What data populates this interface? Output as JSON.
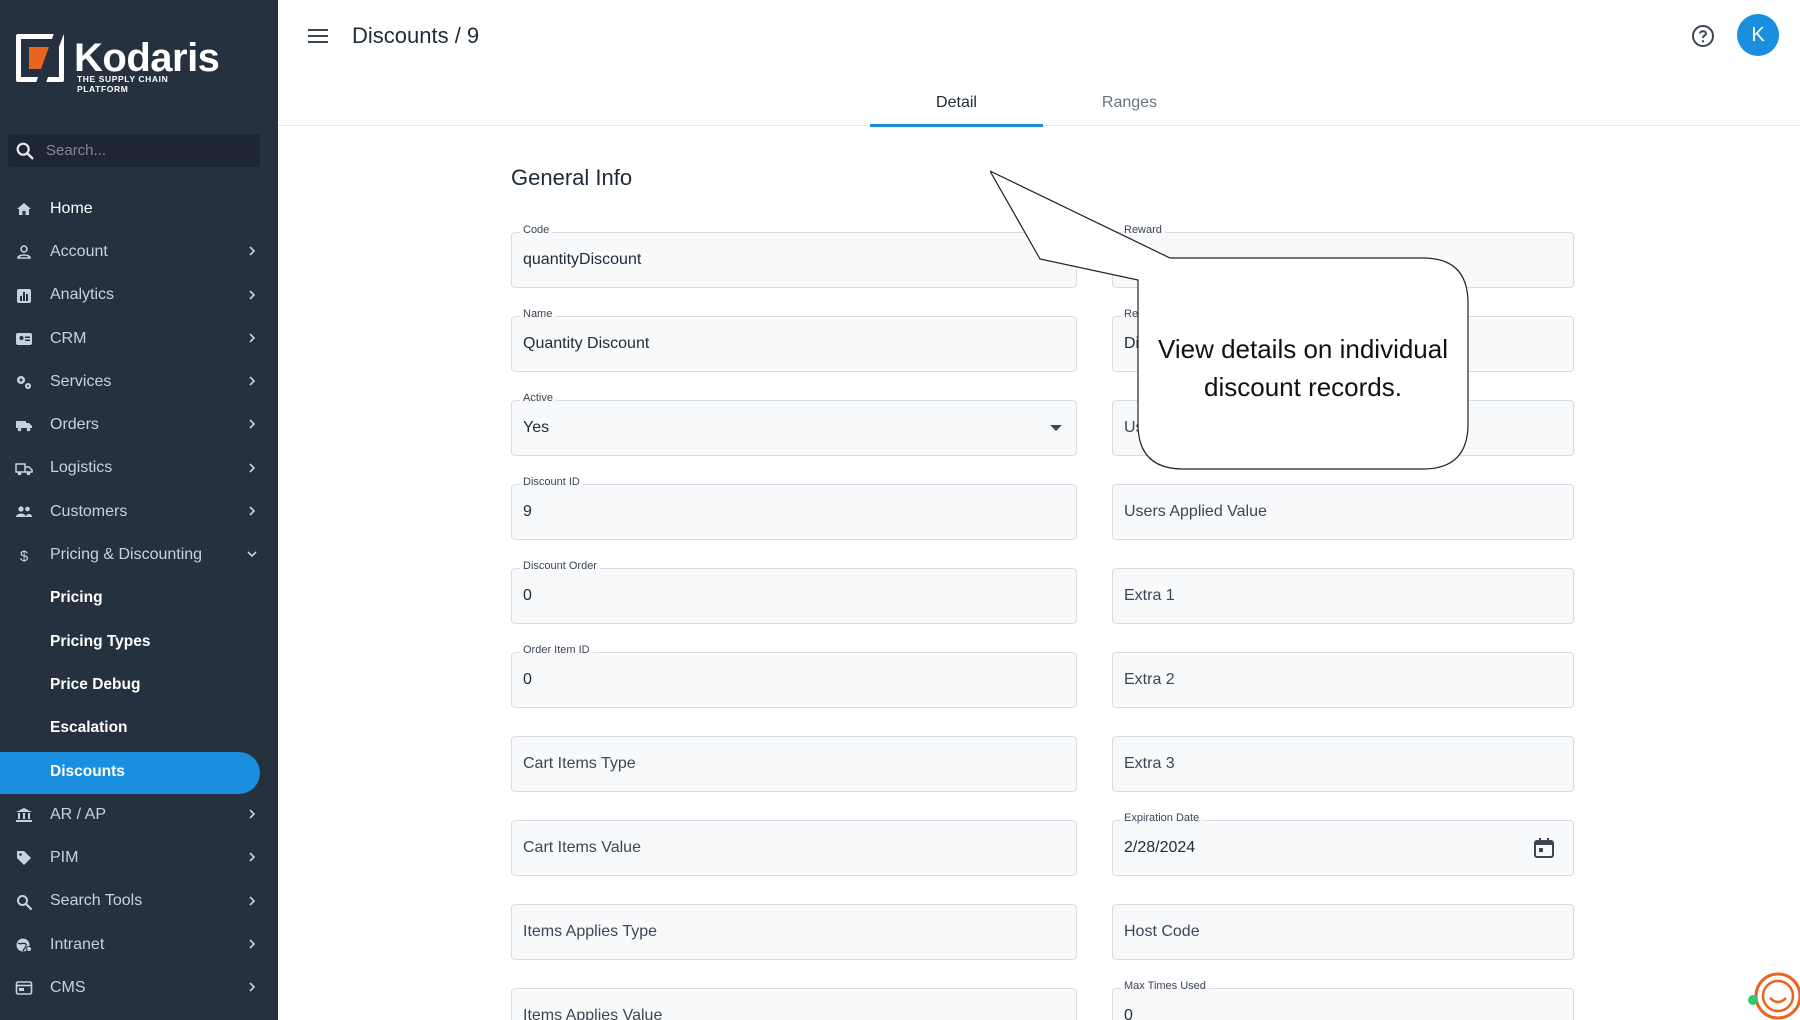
{
  "brand": {
    "name": "Kodaris",
    "tagline": "THE SUPPLY CHAIN PLATFORM",
    "accent": "#1a8fe0",
    "logo_color": "#e7661f"
  },
  "search": {
    "placeholder": "Search..."
  },
  "nav": {
    "home": "Home",
    "account": "Account",
    "analytics": "Analytics",
    "crm": "CRM",
    "services": "Services",
    "orders": "Orders",
    "logistics": "Logistics",
    "customers": "Customers",
    "pricing_discounting": "Pricing & Discounting",
    "pricing": "Pricing",
    "pricing_types": "Pricing Types",
    "price_debug": "Price Debug",
    "escalation": "Escalation",
    "discounts": "Discounts",
    "ar_ap": "AR / AP",
    "pim": "PIM",
    "search_tools": "Search Tools",
    "intranet": "Intranet",
    "cms": "CMS"
  },
  "header": {
    "title": "Discounts / 9",
    "avatar_initial": "K"
  },
  "tabs": {
    "detail": "Detail",
    "ranges": "Ranges"
  },
  "section": {
    "title": "General Info"
  },
  "form": {
    "code": {
      "label": "Code",
      "value": "quantityDiscount"
    },
    "name": {
      "label": "Name",
      "value": "Quantity Discount"
    },
    "active": {
      "label": "Active",
      "value": "Yes"
    },
    "discount_id": {
      "label": "Discount ID",
      "value": "9"
    },
    "discount_order": {
      "label": "Discount Order",
      "value": "0"
    },
    "order_item_id": {
      "label": "Order Item ID",
      "value": "0"
    },
    "cart_items_type": {
      "placeholder": "Cart Items Type"
    },
    "cart_items_value": {
      "placeholder": "Cart Items Value"
    },
    "items_applies_type": {
      "placeholder": "Items Applies Type"
    },
    "items_applies_value": {
      "placeholder": "Items Applies Value"
    },
    "reward": {
      "label": "Reward"
    },
    "reward_type": {
      "label": "Re",
      "value": "Di"
    },
    "users_applied_type": {
      "value": "Us"
    },
    "users_applied_value": {
      "placeholder": "Users Applied Value"
    },
    "extra1": {
      "placeholder": "Extra 1"
    },
    "extra2": {
      "placeholder": "Extra 2"
    },
    "extra3": {
      "placeholder": "Extra 3"
    },
    "expiration_date": {
      "label": "Expiration Date",
      "value": "2/28/2024"
    },
    "host_code": {
      "placeholder": "Host Code"
    },
    "max_times_used": {
      "label": "Max Times Used",
      "value": "0"
    }
  },
  "callout": {
    "line1": "View details on individual",
    "line2": "discount records."
  }
}
